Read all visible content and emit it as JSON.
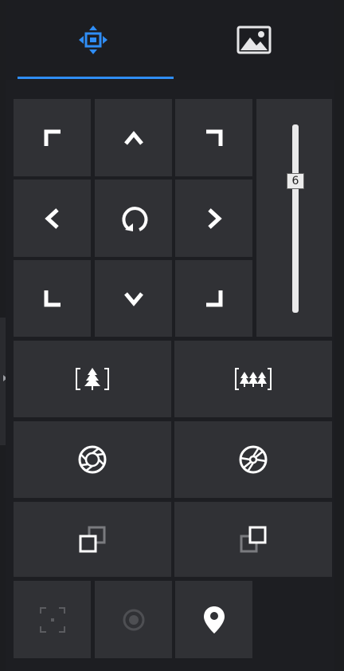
{
  "tabs": [
    {
      "icon": "ptz-control-icon",
      "active": true
    },
    {
      "icon": "image-settings-icon",
      "active": false
    }
  ],
  "ptz": {
    "direction_pad": [
      "up-left-arrow-icon",
      "up-arrow-icon",
      "up-right-arrow-icon",
      "left-arrow-icon",
      "auto-rotate-icon",
      "right-arrow-icon",
      "down-left-arrow-icon",
      "down-arrow-icon",
      "down-right-arrow-icon"
    ],
    "speed": {
      "value": "6",
      "min": 1,
      "max": 8
    },
    "zoom": {
      "wide_icon": "zoom-in-icon",
      "tele_icon": "zoom-out-icon"
    },
    "iris": {
      "open_icon": "iris-open-icon",
      "close_icon": "iris-close-icon"
    },
    "focus": {
      "near_icon": "focus-near-icon",
      "far_icon": "focus-far-icon"
    },
    "tools": [
      {
        "icon": "regional-focus-icon",
        "enabled": false
      },
      {
        "icon": "light-icon",
        "enabled": false
      },
      {
        "icon": "location-pin-icon",
        "enabled": true
      }
    ]
  },
  "colors": {
    "accent": "#2f8df5",
    "button": "#303135",
    "background": "#1d1e22",
    "icon": "#ffffff"
  }
}
